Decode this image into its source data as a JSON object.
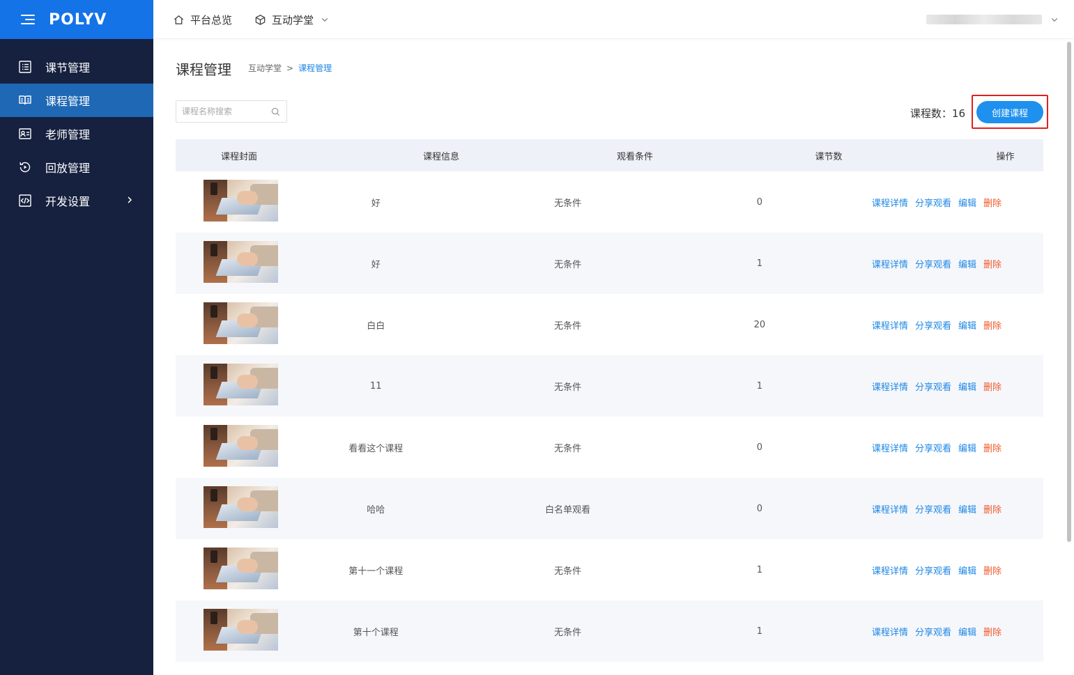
{
  "app": {
    "logo": "POLYV"
  },
  "sidebar": {
    "items": [
      {
        "label": "课节管理",
        "icon": "list-icon",
        "active": false
      },
      {
        "label": "课程管理",
        "icon": "book-icon",
        "active": true
      },
      {
        "label": "老师管理",
        "icon": "id-card-icon",
        "active": false
      },
      {
        "label": "回放管理",
        "icon": "replay-icon",
        "active": false
      },
      {
        "label": "开发设置",
        "icon": "code-icon",
        "active": false,
        "has_submenu": true
      }
    ]
  },
  "header": {
    "overview_label": "平台总览",
    "module_label": "互动学堂"
  },
  "page": {
    "title": "课程管理",
    "breadcrumb": [
      "互动学堂",
      "课程管理"
    ],
    "breadcrumb_sep": ">",
    "search_placeholder": "课程名称搜索",
    "count_label": "课程数：",
    "count_value": "16",
    "create_button": "创建课程"
  },
  "table": {
    "columns": [
      "课程封面",
      "课程信息",
      "观看条件",
      "课节数",
      "操作"
    ],
    "action_labels": {
      "detail": "课程详情",
      "share": "分享观看",
      "edit": "编辑",
      "delete": "删除"
    },
    "rows": [
      {
        "name": "好",
        "condition": "无条件",
        "sessions": "0"
      },
      {
        "name": "好",
        "condition": "无条件",
        "sessions": "1"
      },
      {
        "name": "白白",
        "condition": "无条件",
        "sessions": "20"
      },
      {
        "name": "11",
        "condition": "无条件",
        "sessions": "1"
      },
      {
        "name": "看看这个课程",
        "condition": "无条件",
        "sessions": "0"
      },
      {
        "name": "哈哈",
        "condition": "白名单观看",
        "sessions": "0"
      },
      {
        "name": "第十一个课程",
        "condition": "无条件",
        "sessions": "1"
      },
      {
        "name": "第十个课程",
        "condition": "无条件",
        "sessions": "1"
      }
    ]
  },
  "colors": {
    "sidebar_bg": "#16213f",
    "logo_bar": "#1473e6",
    "active_nav": "#1f68b5",
    "link": "#1e88e5",
    "danger": "#f05a2a",
    "highlight": "#e02020"
  }
}
